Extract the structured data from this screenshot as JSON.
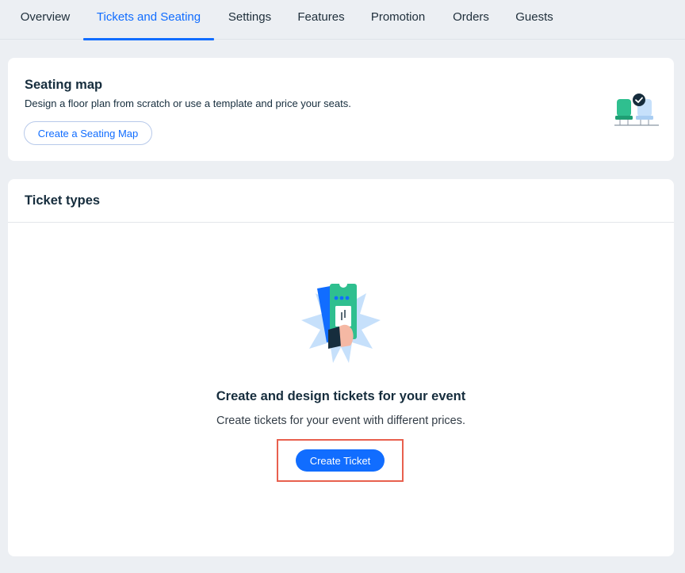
{
  "tabs": [
    {
      "label": "Overview",
      "active": false
    },
    {
      "label": "Tickets and Seating",
      "active": true
    },
    {
      "label": "Settings",
      "active": false
    },
    {
      "label": "Features",
      "active": false
    },
    {
      "label": "Promotion",
      "active": false
    },
    {
      "label": "Orders",
      "active": false
    },
    {
      "label": "Guests",
      "active": false
    }
  ],
  "seating": {
    "title": "Seating map",
    "description": "Design a floor plan from scratch or use a template and price your seats.",
    "button_label": "Create a Seating Map",
    "icon": "seats-illustration-icon"
  },
  "tickets": {
    "title": "Ticket types",
    "empty_title": "Create and design tickets for your event",
    "empty_description": "Create tickets for your event with different prices.",
    "button_label": "Create Ticket",
    "icon": "ticket-illustration-icon"
  },
  "colors": {
    "accent": "#116dff",
    "highlight": "#e8604e",
    "background": "#eceff3",
    "illustration_green": "#2fbf8f",
    "illustration_light_blue": "#c6e0fb"
  }
}
